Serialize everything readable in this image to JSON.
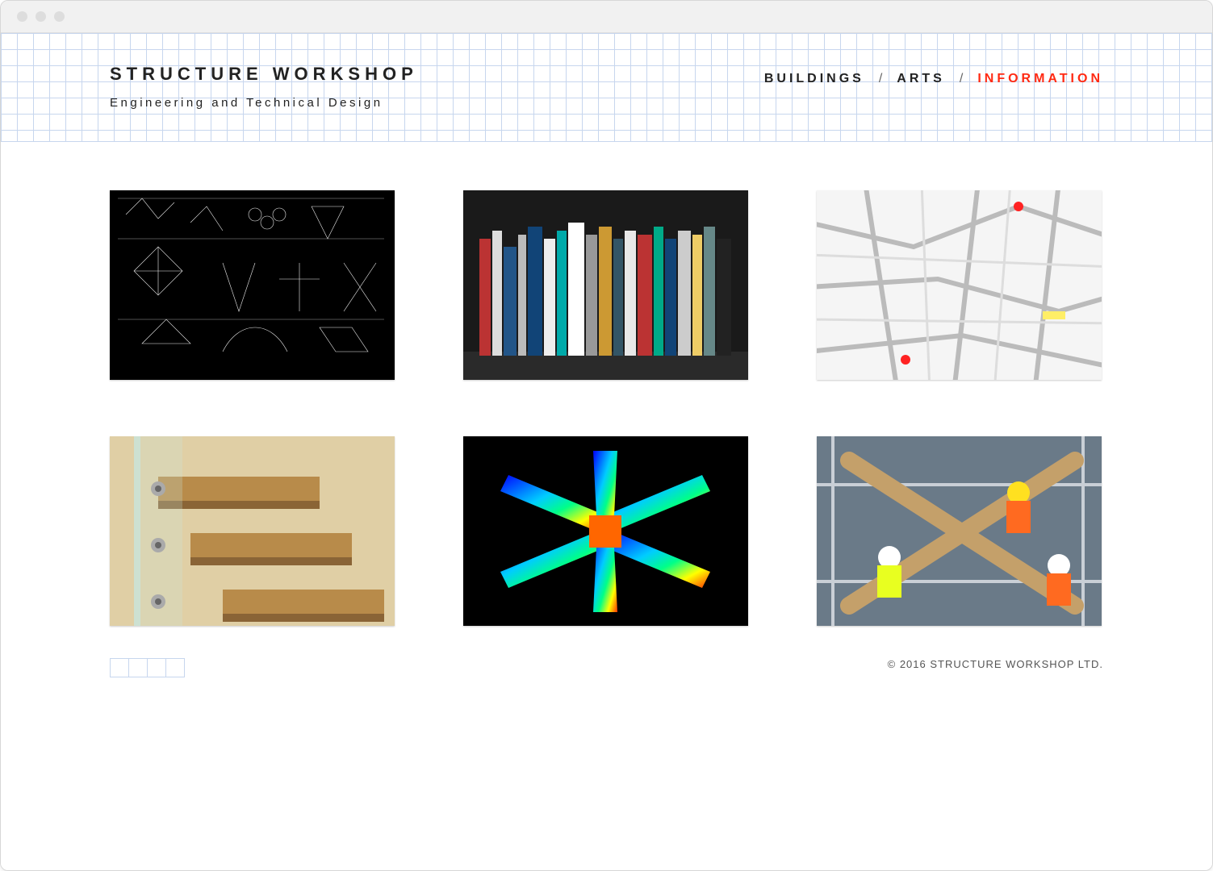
{
  "logo": {
    "title": "STRUCTURE WORKSHOP",
    "subtitle": "Engineering and Technical Design"
  },
  "nav": {
    "items": [
      {
        "label": "BUILDINGS",
        "active": false
      },
      {
        "label": "ARTS",
        "active": false
      },
      {
        "label": "INFORMATION",
        "active": true
      }
    ],
    "separator": "/"
  },
  "gallery": {
    "tiles": [
      {
        "name": "drawings-sketches"
      },
      {
        "name": "bookshelf-library"
      },
      {
        "name": "location-map"
      },
      {
        "name": "timber-stair-detail"
      },
      {
        "name": "fea-analysis-render"
      },
      {
        "name": "site-workers-truss"
      }
    ]
  },
  "footer": {
    "copyright": "© 2016 STRUCTURE WORKSHOP LTD."
  }
}
